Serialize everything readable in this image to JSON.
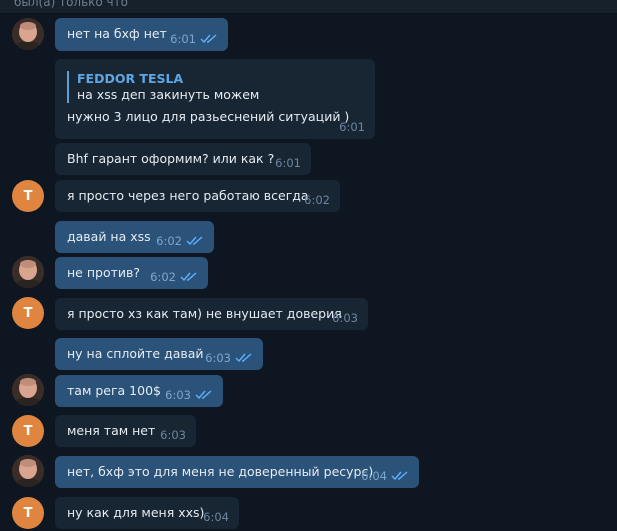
{
  "header": {
    "status": "был(а) только что"
  },
  "avatars": {
    "t_letter": "Т"
  },
  "messages": [
    {
      "text": "нет на бхф нет",
      "time": "6:01"
    },
    {
      "quote_name": "FEDDOR TESLA",
      "quote_text": "на xss деп закинуть можем",
      "text": "нужно 3 лицо для разьеснений ситуаций )",
      "time": "6:01"
    },
    {
      "text": "Bhf  гарант оформим? или как ?",
      "time": "6:01"
    },
    {
      "text": "я просто через него работаю всегда",
      "time": "6:02"
    },
    {
      "text": "давай на xss",
      "time": "6:02"
    },
    {
      "text": "не против?",
      "time": "6:02"
    },
    {
      "text": "я просто хз как там) не внушает доверия",
      "time": "6:03"
    },
    {
      "text": "ну на сплойте давай",
      "time": "6:03"
    },
    {
      "text": "там рега 100$",
      "time": "6:03"
    },
    {
      "text": "меня там нет",
      "time": "6:03"
    },
    {
      "text": "нет, бхф это для меня не доверенный ресурс)",
      "time": "6:04"
    },
    {
      "text": "ну как для меня xxs)",
      "time": "6:04"
    }
  ],
  "colors": {
    "background": "#0e1621",
    "incoming_bubble": "#182533",
    "outgoing_bubble": "#2b5278",
    "avatar_t": "#e0853f",
    "read_check": "#5fb0ff"
  }
}
